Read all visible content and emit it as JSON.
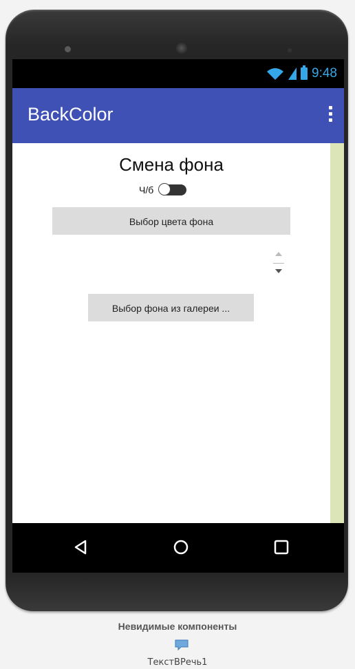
{
  "status_bar": {
    "time": "9:48",
    "icons": [
      "wifi-icon",
      "signal-icon",
      "battery-icon"
    ]
  },
  "app_bar": {
    "title": "BackColor",
    "menu_icon": "more-vert-icon",
    "color": "#3f51b5"
  },
  "main": {
    "heading": "Смена фона",
    "bw_switch": {
      "label": "Ч/б",
      "checked": false
    },
    "color_button": "Выбор цвета фона",
    "gallery_button": "Выбор фона из галереи ..."
  },
  "nav_bar": {
    "icons": [
      "back-icon",
      "home-icon",
      "recents-icon"
    ]
  },
  "invisible_components": {
    "title": "Невидимые компоненты",
    "items": [
      {
        "icon": "speech-bubble-icon",
        "label": "ТекстВРечь1"
      }
    ]
  }
}
